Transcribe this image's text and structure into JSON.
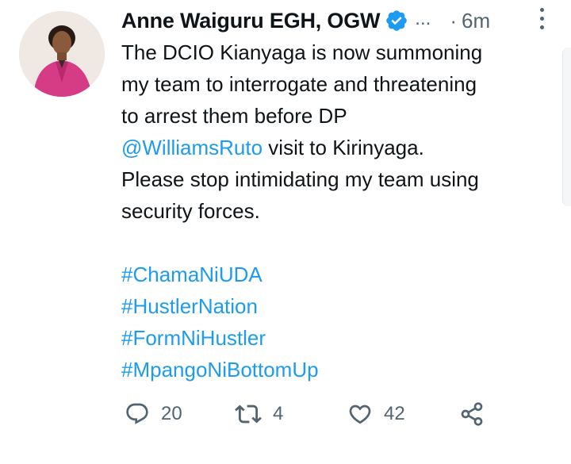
{
  "tweet": {
    "author_name": "Anne Waiguru EGH, OGW",
    "ellipsis": "...",
    "separator": "·",
    "time": "6m",
    "body": {
      "line1": "The DCIO Kianyaga is now summoning",
      "line2": "my team to interrogate and threatening",
      "line3": "to arrest them before DP",
      "mention": "@WilliamsRuto",
      "line4_rest": " visit to Kirinyaga.",
      "line5": "Please stop intimidating my team using",
      "line6": "security forces."
    },
    "hashtags": [
      "#ChamaNiUDA",
      "#HustlerNation",
      "#FormNiHustler",
      "#MpangoNiBottomUp"
    ],
    "actions": {
      "replies": "20",
      "retweets": "4",
      "likes": "42"
    }
  },
  "colors": {
    "link": "#1d9bf0",
    "muted": "#536471",
    "text": "#0f1419",
    "verified": "#1d9bf0"
  },
  "icons": [
    "verified-badge-icon",
    "more-options-icon",
    "reply-icon",
    "retweet-icon",
    "like-icon",
    "share-icon"
  ]
}
